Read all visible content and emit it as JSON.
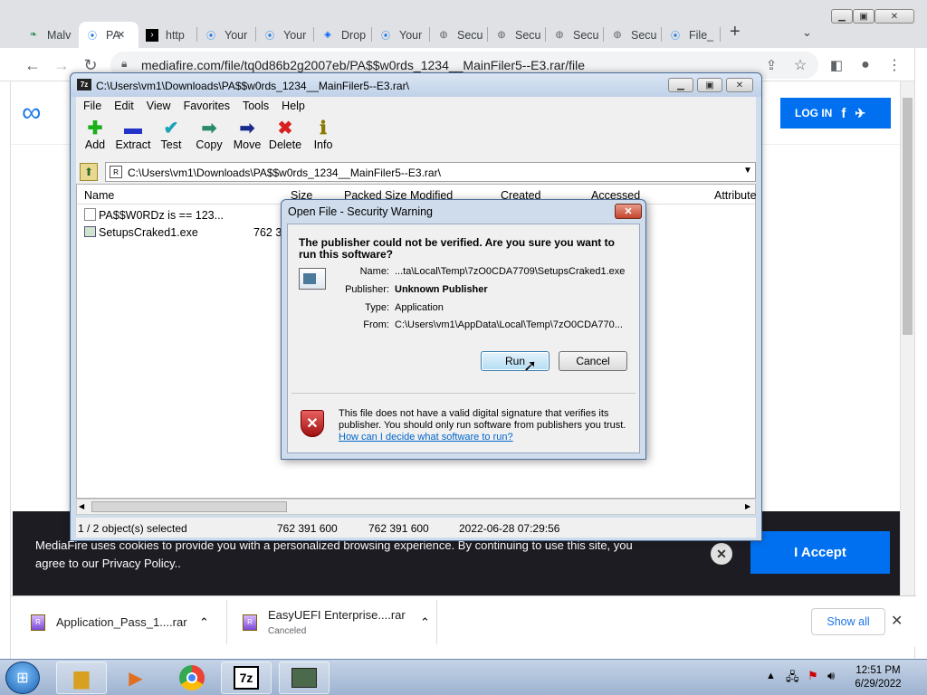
{
  "browser": {
    "tabs": [
      {
        "label": "Malv",
        "icon": "leaf-favicon"
      },
      {
        "label": "PA",
        "icon": "mediafire-favicon",
        "active": true
      },
      {
        "label": "http",
        "icon": "terminal-favicon"
      },
      {
        "label": "Your",
        "icon": "mediafire-favicon"
      },
      {
        "label": "Your",
        "icon": "mediafire-favicon"
      },
      {
        "label": "Drop",
        "icon": "dropbox-favicon"
      },
      {
        "label": "Your",
        "icon": "mediafire-favicon"
      },
      {
        "label": "Secu",
        "icon": "globe-favicon"
      },
      {
        "label": "Secu",
        "icon": "globe-favicon"
      },
      {
        "label": "Secu",
        "icon": "globe-favicon"
      },
      {
        "label": "Secu",
        "icon": "globe-favicon"
      },
      {
        "label": "File_",
        "icon": "mediafire-favicon"
      }
    ],
    "tab_close": "✕",
    "new_tab": "+",
    "url": "mediafire.com/file/tq0d86b2g2007eb/PA$$w0rds_1234__MainFiler5--E3.rar/file"
  },
  "page": {
    "login": "LOG IN",
    "cookie_text": "MediaFire uses cookies to provide you with a personalized browsing experience. By continuing to use this site, you agree to our Privacy Policy..",
    "accept": "I Accept",
    "close": "✕"
  },
  "downloads": {
    "items": [
      {
        "name": "Application_Pass_1....rar",
        "status": ""
      },
      {
        "name": "EasyUEFI Enterprise....rar",
        "status": "Canceled"
      }
    ],
    "show_all": "Show all",
    "close": "✕"
  },
  "sevenzip": {
    "title": "C:\\Users\\vm1\\Downloads\\PA$$w0rds_1234__MainFiler5--E3.rar\\",
    "menu": [
      "File",
      "Edit",
      "View",
      "Favorites",
      "Tools",
      "Help"
    ],
    "tools": [
      {
        "label": "Add",
        "glyph": "✚",
        "color": "#19b019"
      },
      {
        "label": "Extract",
        "glyph": "▬",
        "color": "#2332c8"
      },
      {
        "label": "Test",
        "glyph": "✔",
        "color": "#1aa3b8"
      },
      {
        "label": "Copy",
        "glyph": "➡",
        "color": "#2a8a6a"
      },
      {
        "label": "Move",
        "glyph": "➡",
        "color": "#1a2a8a"
      },
      {
        "label": "Delete",
        "glyph": "✖",
        "color": "#d82020"
      },
      {
        "label": "Info",
        "glyph": "ℹ",
        "color": "#8a7a00"
      }
    ],
    "path": "C:\\Users\\vm1\\Downloads\\PA$$w0rds_1234__MainFiler5--E3.rar\\",
    "columns": [
      "Name",
      "Size",
      "Packed Size",
      "Modified",
      "Created",
      "Accessed",
      "Attribute"
    ],
    "rows": [
      {
        "name": "PA$$W0RDz is  ==  123...",
        "size": ""
      },
      {
        "name": "SetupsCraked1.exe",
        "size": "762 39"
      }
    ],
    "status": {
      "selected": "1 / 2 object(s) selected",
      "size": "762 391 600",
      "packed": "762 391 600",
      "date": "2022-06-28 07:29:56"
    }
  },
  "dialog": {
    "title": "Open File - Security Warning",
    "question": "The publisher could not be verified.  Are you sure you want to run this software?",
    "fields": [
      {
        "k": "Name:",
        "v": "...ta\\Local\\Temp\\7zO0CDA7709\\SetupsCraked1.exe",
        "bold": true
      },
      {
        "k": "Publisher:",
        "v": "Unknown Publisher",
        "bold": true
      },
      {
        "k": "Type:",
        "v": "Application",
        "bold": false
      },
      {
        "k": "From:",
        "v": "C:\\Users\\vm1\\AppData\\Local\\Temp\\7zO0CDA770...",
        "bold": false
      }
    ],
    "run": "Run",
    "cancel": "Cancel",
    "warning": "This file does not have a valid digital signature that verifies its publisher.  You should only run software from publishers you trust.",
    "link": "How can I decide what software to run?"
  },
  "taskbar": {
    "time": "12:51 PM",
    "date": "6/29/2022"
  }
}
